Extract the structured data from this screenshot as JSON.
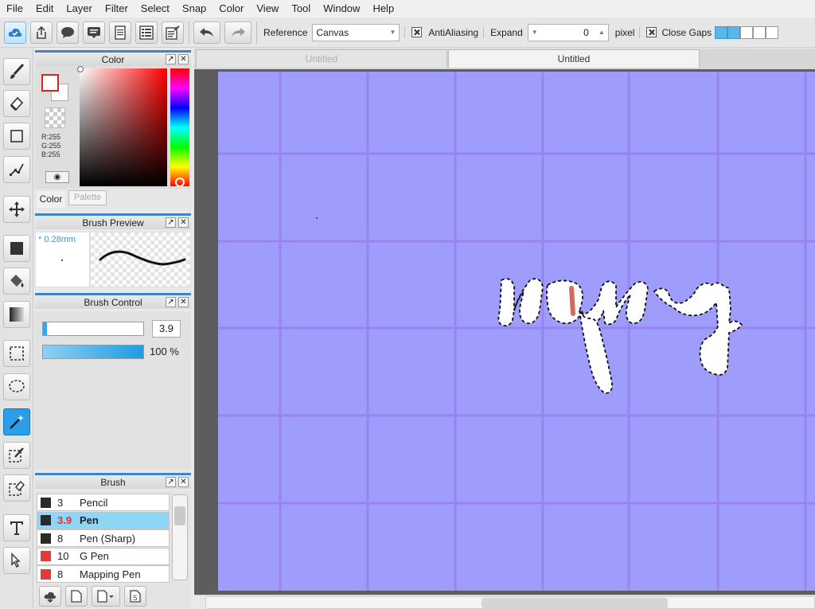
{
  "menu": [
    "File",
    "Edit",
    "Layer",
    "Filter",
    "Select",
    "Snap",
    "Color",
    "View",
    "Tool",
    "Window",
    "Help"
  ],
  "toolbar": {
    "reference_label": "Reference",
    "reference_value": "Canvas",
    "antialiasing_label": "AntiAliasing",
    "expand_label": "Expand",
    "expand_value": "0",
    "expand_unit": "pixel",
    "close_gaps_label": "Close Gaps"
  },
  "panels": {
    "color": {
      "title": "Color",
      "r": "R:255",
      "g": "G:255",
      "b": "B:255",
      "tab_color": "Color",
      "tab_palette": "Palette"
    },
    "brush_preview": {
      "title": "Brush Preview",
      "size": "* 0.28mm"
    },
    "brush_control": {
      "title": "Brush Control",
      "size_value": "3.9",
      "opacity_value": "100 %",
      "size_fraction": 0.039,
      "opacity_fraction": 1.0
    },
    "brush": {
      "title": "Brush",
      "items": [
        {
          "size": "3",
          "name": "Pencil",
          "color": "#2a2a2a",
          "selected": false
        },
        {
          "size": "3.9",
          "name": "Pen",
          "color": "#2a2a2a",
          "selected": true
        },
        {
          "size": "8",
          "name": "Pen (Sharp)",
          "color": "#2a2a2a",
          "selected": false
        },
        {
          "size": "10",
          "name": "G Pen",
          "color": "#e23b3b",
          "selected": false
        },
        {
          "size": "8",
          "name": "Mapping Pen",
          "color": "#e23b3b",
          "selected": false
        }
      ]
    }
  },
  "tabs": [
    "Untitled",
    "Untitled"
  ],
  "colors": {
    "canvas": "#9f9dfb",
    "grid": "#9780f0",
    "accent": "#2a9ee8",
    "selected_row": "#8ed6f3"
  }
}
